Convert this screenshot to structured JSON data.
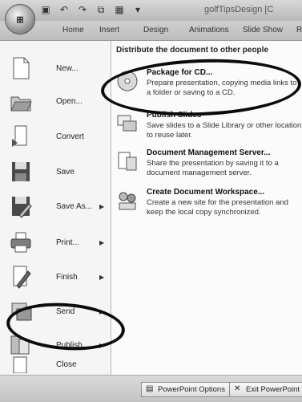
{
  "window": {
    "title": "golfTipsDesign [C"
  },
  "ribbon_tabs": [
    "Home",
    "Insert",
    "Design",
    "Animations",
    "Slide Show",
    "R"
  ],
  "office_button": {
    "label": ""
  },
  "menu_left": [
    {
      "label": "New...",
      "has_arrow": false,
      "icon": "new-document-icon"
    },
    {
      "label": "Open...",
      "has_arrow": false,
      "icon": "open-folder-icon"
    },
    {
      "label": "Convert",
      "has_arrow": false,
      "icon": "convert-icon"
    },
    {
      "label": "Save",
      "has_arrow": false,
      "icon": "save-disk-icon"
    },
    {
      "label": "Save As...",
      "has_arrow": true,
      "icon": "save-as-icon"
    },
    {
      "label": "Print...",
      "has_arrow": true,
      "icon": "printer-icon"
    },
    {
      "label": "Finish",
      "has_arrow": true,
      "icon": "finish-pen-icon"
    },
    {
      "label": "Send",
      "has_arrow": true,
      "icon": "send-icon"
    },
    {
      "label": "Publish",
      "has_arrow": true,
      "icon": "publish-icon"
    },
    {
      "label": "Close",
      "has_arrow": false,
      "icon": "close-document-icon"
    }
  ],
  "submenu": {
    "heading": "Distribute the document to other people",
    "options": [
      {
        "title": "Package for CD...",
        "desc": "Prepare presentation, copying media links to a folder or saving to a CD.",
        "icon": "cd-icon"
      },
      {
        "title": "Publish Slides",
        "desc": "Save slides to a Slide Library or other location to reuse later.",
        "icon": "publish-slides-icon"
      },
      {
        "title": "Document Management Server...",
        "desc": "Share the presentation by saving it to a document management server.",
        "icon": "document-server-icon"
      },
      {
        "title": "Create Document Workspace...",
        "desc": "Create a new site for the presentation and keep the local copy synchronized.",
        "icon": "workspace-icon"
      }
    ]
  },
  "bottom_buttons": {
    "options": "PowerPoint Options",
    "exit": "Exit PowerPoint"
  }
}
